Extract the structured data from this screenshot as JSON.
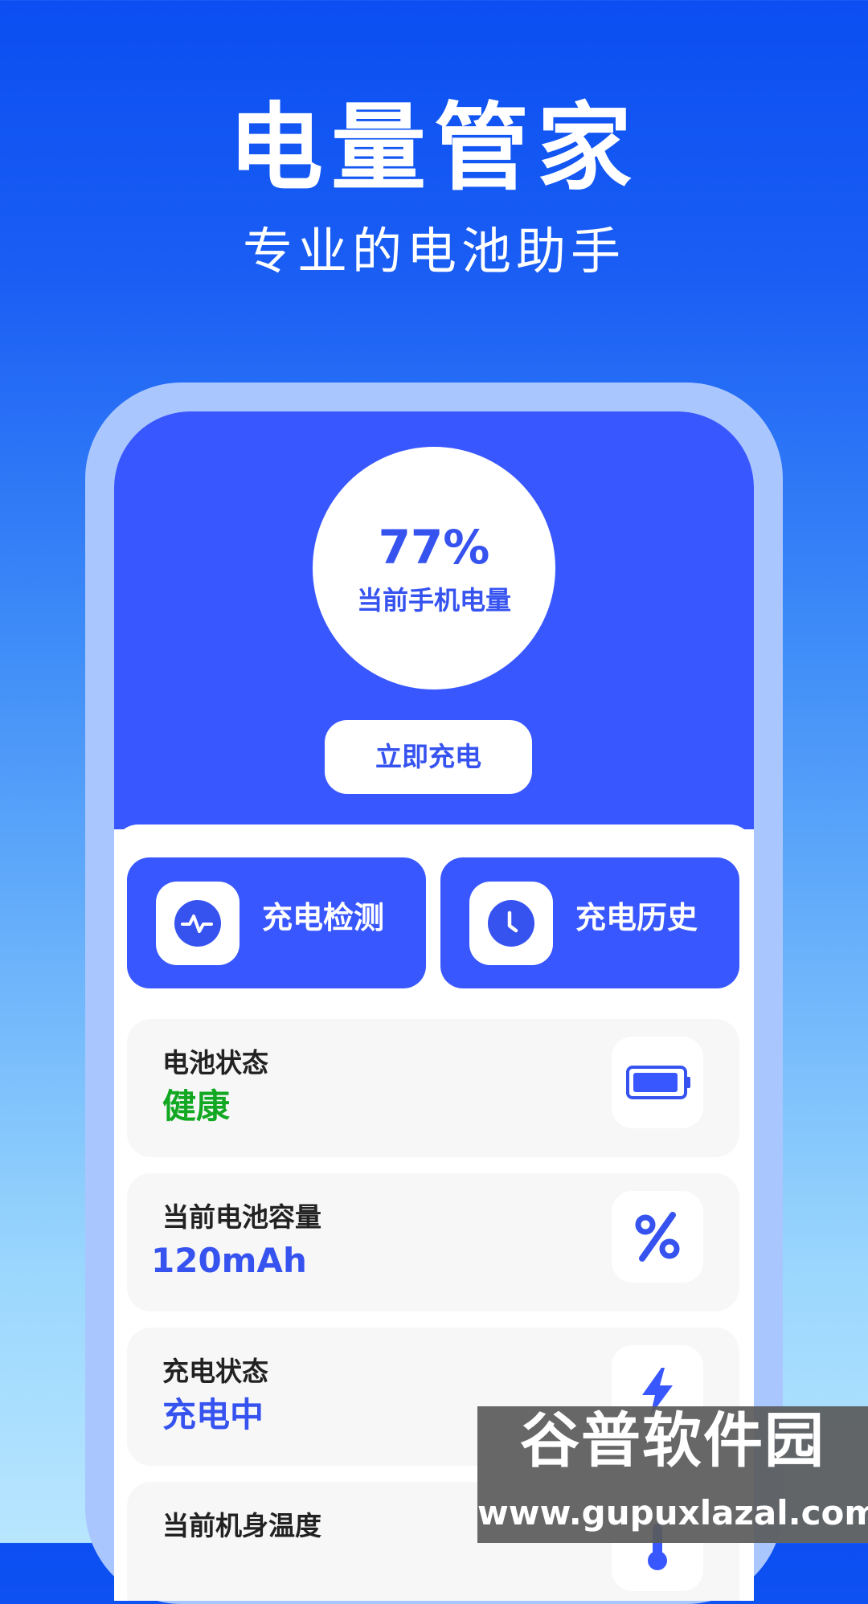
{
  "hero": {
    "title": "电量管家",
    "subtitle": "专业的电池助手"
  },
  "battery": {
    "percent": "77%",
    "caption": "当前手机电量",
    "charge_now_label": "立即充电"
  },
  "actions": [
    {
      "label": "充电检测",
      "icon": "heartbeat-icon"
    },
    {
      "label": "充电历史",
      "icon": "clock-icon"
    }
  ],
  "info_cards": [
    {
      "label": "电池状态",
      "value": "健康",
      "value_color": "#12a822",
      "icon": "battery-icon"
    },
    {
      "label": "当前电池容量",
      "value": "120mAh",
      "value_color": "#3653f0",
      "icon": "percent-icon"
    },
    {
      "label": "充电状态",
      "value": "充电中",
      "value_color": "#3653f0",
      "icon": "lightning-icon"
    },
    {
      "label": "当前机身温度",
      "value": "",
      "value_color": "#3653f0",
      "icon": "thermometer-icon"
    }
  ],
  "watermark": {
    "main": "谷普软件园",
    "sub": "www.gupuxlazal.com"
  },
  "colors": {
    "primary": "#3957ff",
    "accent_blue": "#3653f0",
    "healthy_green": "#12a822",
    "card_bg": "#f7f7f8"
  }
}
